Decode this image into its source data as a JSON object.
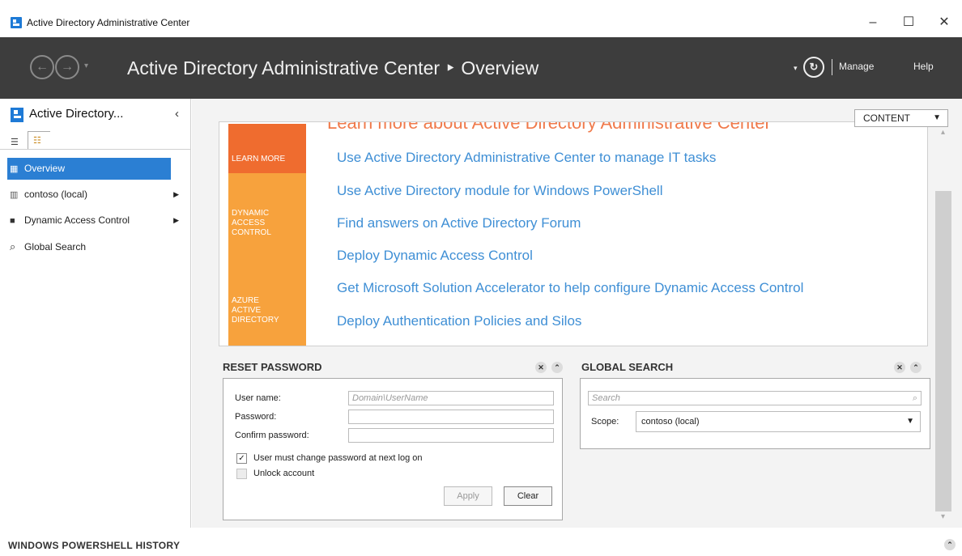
{
  "window": {
    "title": "Active Directory Administrative Center",
    "minimize": "–",
    "maximize": "☐",
    "close": "✕"
  },
  "header": {
    "back": "←",
    "forward": "→",
    "dropdown": "▾",
    "breadcrumb": "Active Directory Administrative Center ‣ Overview",
    "refresh_arrow": "▾",
    "refresh": "↻",
    "manage": "Manage",
    "help": "Help"
  },
  "sidebar": {
    "title": "Active Directory...",
    "collapse": "‹",
    "list_view_icon": "☰",
    "tree_view_icon": "☷",
    "items": [
      {
        "label": "Overview",
        "icon": "▦",
        "arrow": ""
      },
      {
        "label": "contoso (local)",
        "icon": "▥",
        "arrow": "▶"
      },
      {
        "label": "Dynamic Access Control",
        "icon": "■",
        "arrow": "▶"
      },
      {
        "label": "Global Search",
        "icon": "⌕",
        "arrow": ""
      }
    ]
  },
  "content": {
    "dropdown_label": "CONTENT",
    "dropdown_caret": "▼",
    "heading": "Learn more about Active Directory Administrative Center",
    "categories": {
      "learn": "LEARN MORE",
      "dac": "DYNAMIC\nACCESS\nCONTROL",
      "aad": "AZURE\nACTIVE\nDIRECTORY"
    },
    "links": [
      "Use Active Directory Administrative Center to manage IT tasks",
      "Use Active Directory module for Windows PowerShell",
      "Find answers on Active Directory Forum",
      "Deploy Dynamic Access Control",
      "Get Microsoft Solution Accelerator to help configure Dynamic Access Control",
      "Deploy Authentication Policies and Silos"
    ]
  },
  "scrollbar": {
    "up": "▴",
    "down": "▾"
  },
  "reset_password": {
    "title": "RESET PASSWORD",
    "close": "✕",
    "collapse": "⌃",
    "username_label": "User name:",
    "username_placeholder": "Domain\\UserName",
    "password_label": "Password:",
    "confirm_label": "Confirm password:",
    "must_change_label": "User must change password at next log on",
    "must_change_checked": "✓",
    "unlock_label": "Unlock account",
    "apply": "Apply",
    "clear": "Clear"
  },
  "global_search": {
    "title": "GLOBAL SEARCH",
    "close": "✕",
    "collapse": "⌃",
    "search_placeholder": "Search",
    "search_icon": "⌕",
    "scope_label": "Scope:",
    "scope_value": "contoso (local)",
    "scope_caret": "▼"
  },
  "powershell_history": {
    "title": "WINDOWS POWERSHELL HISTORY",
    "expand": "⌃"
  }
}
